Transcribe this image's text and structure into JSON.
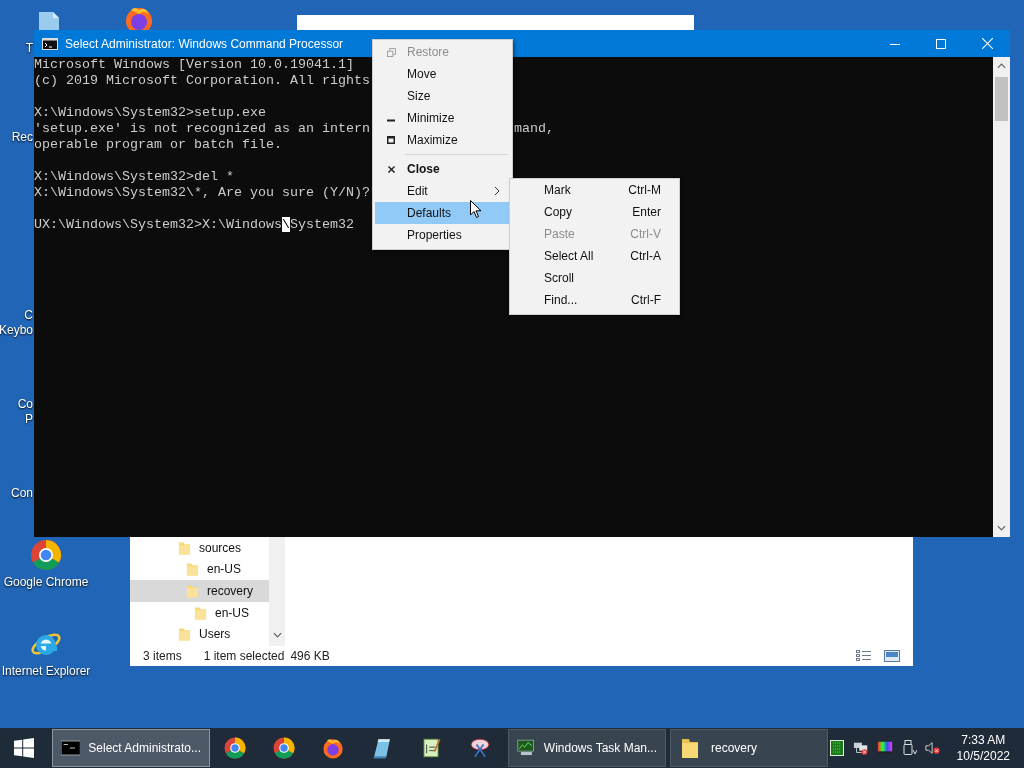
{
  "desktop_icons": [
    {
      "kind": "partial",
      "label": [
        "T"
      ]
    },
    {
      "kind": "partial",
      "label": [
        "Rec"
      ]
    },
    {
      "kind": "partial",
      "label": [
        "C",
        "Keybo"
      ]
    },
    {
      "kind": "partial",
      "label": [
        "Co",
        "P"
      ]
    },
    {
      "kind": "partial",
      "label": [
        "Con"
      ]
    },
    {
      "kind": "chrome",
      "label": [
        "Google Chrome"
      ]
    },
    {
      "kind": "ie",
      "label": [
        "Internet Explorer"
      ]
    }
  ],
  "explorer": {
    "tree": [
      {
        "label": "sources",
        "selected": false,
        "children": [
          {
            "label": "en-US",
            "selected": false
          },
          {
            "label": "recovery",
            "selected": true,
            "children": [
              {
                "label": "en-US",
                "selected": false
              }
            ]
          }
        ]
      },
      {
        "label": "Users",
        "selected": false
      }
    ],
    "status": {
      "item_count": "3 items",
      "selection": "1 item selected",
      "size": "496 KB"
    }
  },
  "console": {
    "title": "Select Administrator: Windows Command Processor",
    "lines": [
      {
        "kind": "text",
        "text": "Microsoft Windows [Version 10.0.19041.1]"
      },
      {
        "kind": "text",
        "text": "(c) 2019 Microsoft Corporation. All rights"
      },
      {
        "kind": "blank"
      },
      {
        "kind": "text",
        "text": "X:\\Windows\\System32>setup.exe"
      },
      {
        "kind": "text",
        "text": "'setup.exe' is not recognized as an intern",
        "tail": "mand,"
      },
      {
        "kind": "text",
        "text": "operable program or batch file."
      },
      {
        "kind": "blank"
      },
      {
        "kind": "text",
        "text": "X:\\Windows\\System32>del *"
      },
      {
        "kind": "text",
        "text": "X:\\Windows\\System32\\*, Are you sure (Y/N)?"
      },
      {
        "kind": "blank"
      },
      {
        "kind": "cursor",
        "text": "UX:\\Windows\\System32>X:\\Windows",
        "cursor": "\\",
        "text_after": "System32"
      }
    ]
  },
  "system_menu": {
    "items": [
      {
        "kind": "item",
        "label": "Restore",
        "disabled": true,
        "selected": false
      },
      {
        "kind": "item",
        "label": "Move",
        "disabled": false,
        "selected": false
      },
      {
        "kind": "item",
        "label": "Size",
        "disabled": false,
        "selected": false
      },
      {
        "kind": "item",
        "label": "Minimize",
        "disabled": false,
        "selected": false
      },
      {
        "kind": "item",
        "label": "Maximize",
        "disabled": false,
        "selected": false
      },
      {
        "kind": "separator"
      },
      {
        "kind": "item",
        "label": "Close",
        "default": true,
        "disabled": false,
        "selected": false
      },
      {
        "kind": "item",
        "label": "Edit",
        "submenu": true,
        "disabled": false,
        "selected": false
      },
      {
        "kind": "item",
        "label": "Defaults",
        "disabled": false,
        "selected": true
      },
      {
        "kind": "item",
        "label": "Properties",
        "disabled": false,
        "selected": false
      }
    ]
  },
  "edit_submenu": {
    "items": [
      {
        "label": "Mark",
        "shortcut": "Ctrl-M",
        "disabled": false
      },
      {
        "label": "Copy",
        "shortcut": "Enter",
        "disabled": false
      },
      {
        "label": "Paste",
        "shortcut": "Ctrl-V",
        "disabled": true
      },
      {
        "label": "Select All",
        "shortcut": "Ctrl-A",
        "disabled": false
      },
      {
        "label": "Scroll",
        "disabled": false
      },
      {
        "label": "Find...",
        "shortcut": "Ctrl-F",
        "disabled": false
      }
    ]
  },
  "taskbar": {
    "windows": [
      {
        "label": "Select Administrato...",
        "selected": true
      },
      {
        "label": "Windows Task Man...",
        "selected": false
      },
      {
        "label": "recovery",
        "selected": false
      }
    ],
    "time": "7:33 AM",
    "date": "10/5/2022"
  }
}
